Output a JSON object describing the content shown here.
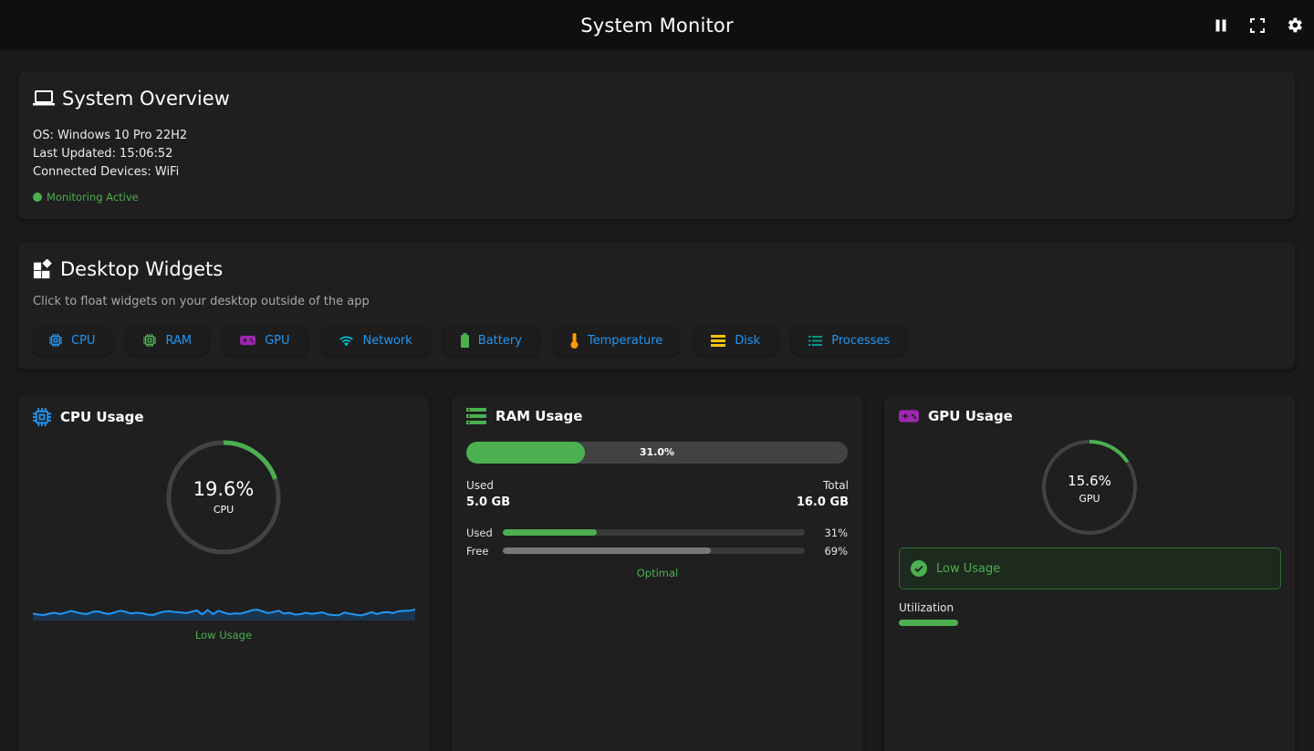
{
  "app": {
    "title": "System Monitor"
  },
  "toolbar": {
    "pause_icon": "pause-icon",
    "fullscreen_icon": "fullscreen-icon",
    "settings_icon": "gear-icon"
  },
  "overview": {
    "heading": "System Overview",
    "os": "OS: Windows 10 Pro 22H2",
    "last_updated": "Last Updated: 15:06:52",
    "devices": "Connected Devices: WiFi",
    "status": "Monitoring Active",
    "status_color": "#4caf50"
  },
  "widgets": {
    "heading": "Desktop Widgets",
    "subtitle": "Click to float widgets on your desktop outside of the app",
    "items": [
      {
        "label": "CPU",
        "icon": "cpu-chip-icon",
        "icon_color": "#2196f3"
      },
      {
        "label": "RAM",
        "icon": "memory-chip-icon",
        "icon_color": "#4caf50"
      },
      {
        "label": "GPU",
        "icon": "gamepad-icon",
        "icon_color": "#9c27b0"
      },
      {
        "label": "Network",
        "icon": "wifi-icon",
        "icon_color": "#00bcd4"
      },
      {
        "label": "Battery",
        "icon": "battery-icon",
        "icon_color": "#4caf50"
      },
      {
        "label": "Temperature",
        "icon": "thermometer-icon",
        "icon_color": "#ff9800"
      },
      {
        "label": "Disk",
        "icon": "storage-icon",
        "icon_color": "#ffc107"
      },
      {
        "label": "Processes",
        "icon": "list-icon",
        "icon_color": "#009688"
      }
    ]
  },
  "cpu": {
    "heading": "CPU Usage",
    "percent_text": "19.6%",
    "percent_value": 19.6,
    "gauge_label": "CPU",
    "status": "Low Usage",
    "history": [
      3.1,
      2.6,
      2.4,
      3.0,
      3.4,
      2.8,
      3.5,
      4.2,
      3.6,
      3.0,
      2.9,
      3.8,
      4.0,
      3.2,
      2.9,
      3.6,
      4.3,
      3.8,
      3.1,
      3.4,
      3.2,
      2.6,
      2.4,
      3.3,
      3.9,
      4.1,
      3.7,
      3.6,
      3.2,
      3.8,
      4.4,
      2.7,
      4.6,
      2.8,
      4.3,
      3.5,
      2.8,
      3.1,
      3.0,
      3.6,
      4.5,
      4.8,
      4.1,
      3.3,
      3.7,
      4.3,
      3.0,
      3.4,
      2.6,
      2.8,
      3.4,
      2.9,
      3.2,
      3.6,
      2.7,
      2.4,
      2.3,
      3.5,
      3.0,
      2.6,
      2.2,
      2.8,
      3.7,
      2.8,
      3.5,
      3.7,
      3.3,
      4.1,
      4.2,
      4.3,
      4.9
    ],
    "colors": {
      "accent": "#4caf50",
      "line": "#2196f3",
      "track": "#424242"
    }
  },
  "ram": {
    "heading": "RAM Usage",
    "bar_text": "31.0%",
    "percent_value": 31.0,
    "used_label": "Used",
    "used_value": "5.0 GB",
    "total_label": "Total",
    "total_value": "16.0 GB",
    "rows": [
      {
        "label": "Used",
        "percent": 31,
        "percent_text": "31%",
        "color": "#4caf50"
      },
      {
        "label": "Free",
        "percent": 69,
        "percent_text": "69%",
        "color": "#777777"
      }
    ],
    "status": "Optimal"
  },
  "gpu": {
    "heading": "GPU Usage",
    "percent_text": "15.6%",
    "percent_value": 15.6,
    "gauge_label": "GPU",
    "alert": "Low Usage",
    "util_label": "Utilization",
    "util_value": 15.6
  }
}
